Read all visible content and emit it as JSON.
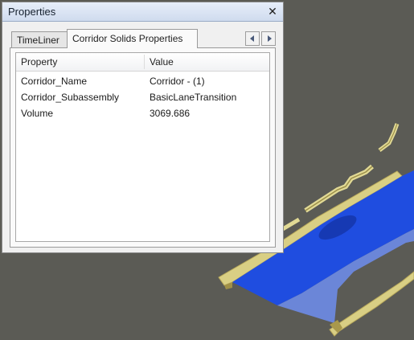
{
  "panel": {
    "title": "Properties",
    "close_glyph": "✕",
    "tabs": [
      {
        "label": "TimeLiner",
        "active": false
      },
      {
        "label": "Corridor Solids Properties",
        "active": true
      }
    ],
    "scroll_left_icon": "triangle-left",
    "scroll_right_icon": "triangle-right"
  },
  "grid": {
    "columns": [
      "Property",
      "Value"
    ],
    "rows": [
      {
        "property": "Corridor_Name",
        "value": "Corridor - (1)"
      },
      {
        "property": "Corridor_Subassembly",
        "value": "BasicLaneTransition"
      },
      {
        "property": "Volume",
        "value": "3069.686"
      }
    ]
  },
  "viewport": {
    "background_color": "#5b5b55",
    "corridor_lane_color": "#1f4de0",
    "corridor_lane_light_color": "#6b86d8",
    "curb_color": "#e0d68a"
  }
}
